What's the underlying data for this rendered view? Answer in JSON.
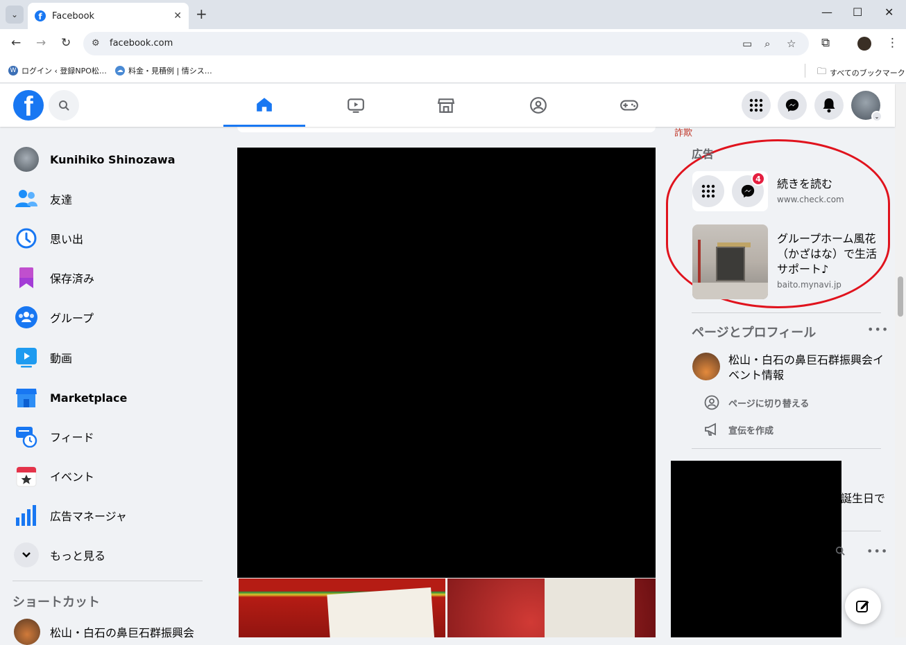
{
  "browser": {
    "tab_title": "Facebook",
    "url": "facebook.com",
    "bookmarks": [
      {
        "label": "ログイン ‹ 登録NPO松…"
      },
      {
        "label": "料金・見積例 | 情シス…"
      }
    ],
    "all_bookmarks": "すべてのブックマーク"
  },
  "sidebar": {
    "profile_name": "Kunihiko Shinozawa",
    "items": [
      {
        "label": "友達",
        "icon": "friends-icon"
      },
      {
        "label": "思い出",
        "icon": "memories-icon"
      },
      {
        "label": "保存済み",
        "icon": "saved-icon"
      },
      {
        "label": "グループ",
        "icon": "groups-icon"
      },
      {
        "label": "動画",
        "icon": "video-icon"
      },
      {
        "label": "Marketplace",
        "icon": "marketplace-icon"
      },
      {
        "label": "フィード",
        "icon": "feed-icon"
      },
      {
        "label": "イベント",
        "icon": "events-icon"
      },
      {
        "label": "広告マネージャ",
        "icon": "ads-manager-icon"
      },
      {
        "label": "もっと見る",
        "icon": "chevron-down-icon"
      }
    ],
    "shortcuts_title": "ショートカット",
    "shortcut": "松山・白石の鼻巨石群振興会"
  },
  "right": {
    "fraud_label": "詐欺",
    "ads_heading": "広告",
    "ads": [
      {
        "title": "続きを読む",
        "url": "www.check.com",
        "badge": "4"
      },
      {
        "title": "グループホーム風花（かざはな）で生活サポート♪",
        "url": "baito.mynavi.jp"
      }
    ],
    "pages_heading": "ページとプロフィール",
    "more": "•••",
    "page_name": "松山・白石の鼻巨石群振興会イベント情報",
    "switch_label": "ページに切り替える",
    "promote_label": "宣伝を作成",
    "birthday_fragment": "誕生日で"
  },
  "colors": {
    "fb_blue": "#1877f2",
    "annotation_red": "#e0131d"
  }
}
